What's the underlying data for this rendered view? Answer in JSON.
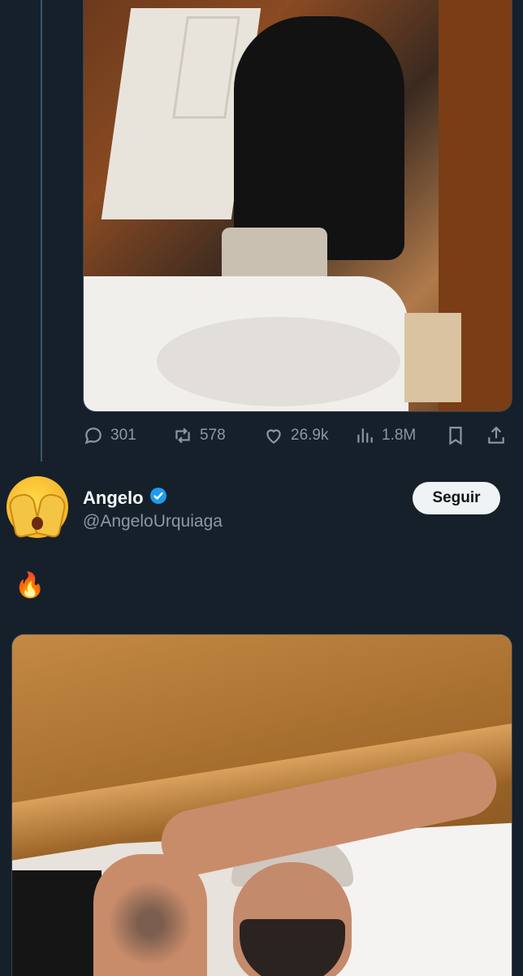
{
  "tweet1": {
    "stats": {
      "replies": "301",
      "retweets": "578",
      "likes": "26.9k",
      "views": "1.8M"
    }
  },
  "tweet2": {
    "name": "Angelo",
    "handle": "@AngeloUrquiaga",
    "follow_label": "Seguir",
    "text": "🔥"
  },
  "colors": {
    "background": "#15202b",
    "secondary_text": "#8b98a5",
    "verified": "#1d9bf0",
    "follow_button_bg": "#eff3f4"
  },
  "icons": [
    "reply-icon",
    "retweet-icon",
    "like-icon",
    "views-icon",
    "bookmark-icon",
    "share-icon",
    "verified-badge-icon"
  ]
}
